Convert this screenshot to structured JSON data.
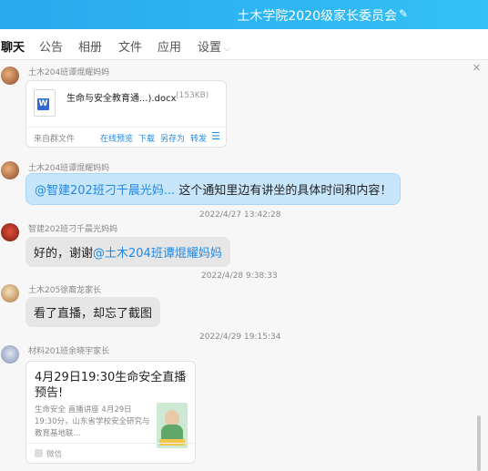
{
  "header": {
    "title": "土木学院2020级家长委员会"
  },
  "tabs": [
    {
      "label": "聊天"
    },
    {
      "label": "公告"
    },
    {
      "label": "相册"
    },
    {
      "label": "文件"
    },
    {
      "label": "应用"
    },
    {
      "label": "设置"
    }
  ],
  "messages": {
    "m1": {
      "sender": "土木204班谭焜耀妈妈",
      "file_name": "生命与安全教育通...).docx",
      "file_size": "(153KB)",
      "source": "来自群文件",
      "actions": [
        "在线预览",
        "下载",
        "另存为",
        "转发"
      ]
    },
    "m2": {
      "sender": "土木204班谭焜耀妈妈",
      "mention": "@智建202班刁千晨光妈...",
      "text": "这个通知里边有讲坐的具体时间和内容！"
    },
    "t1": "2022/4/27 13:42:28",
    "m3": {
      "sender": "智建202班刁千晨光妈妈",
      "text": "好的，谢谢",
      "mention": "@土木204班谭焜耀妈妈"
    },
    "t2": "2022/4/28 9:38:33",
    "m4": {
      "sender": "土木205徐裔龙家长",
      "text": "看了直播，却忘了截图"
    },
    "t3": "2022/4/29 19:15:34",
    "m5": {
      "sender": "材料201班余晓宇家长",
      "card_title": "4月29日19:30生命安全直播预告!",
      "card_desc": "生命安全    直播讲座 4月29日19:30分，山东省学校安全研究与教育基地联...",
      "card_source": "微信"
    }
  },
  "colors": {
    "accent": "#1e88e5",
    "titlebar": "#2aa9ee",
    "blue_bubble": "#c8e6fb"
  }
}
